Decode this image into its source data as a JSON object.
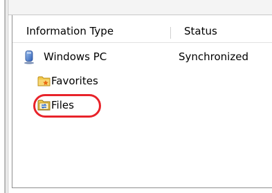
{
  "columns": {
    "type_header": "Information Type",
    "status_header": "Status"
  },
  "tree": {
    "root": {
      "label": "Windows PC",
      "status": "Synchronized",
      "icon": "computer-icon"
    },
    "children": [
      {
        "label": "Favorites",
        "icon": "favorites-folder-icon"
      },
      {
        "label": "Files",
        "icon": "sync-folder-icon",
        "highlighted": true
      }
    ]
  },
  "colors": {
    "highlight_ring": "#e8232a",
    "folder_yellow": "#f2c94c"
  }
}
